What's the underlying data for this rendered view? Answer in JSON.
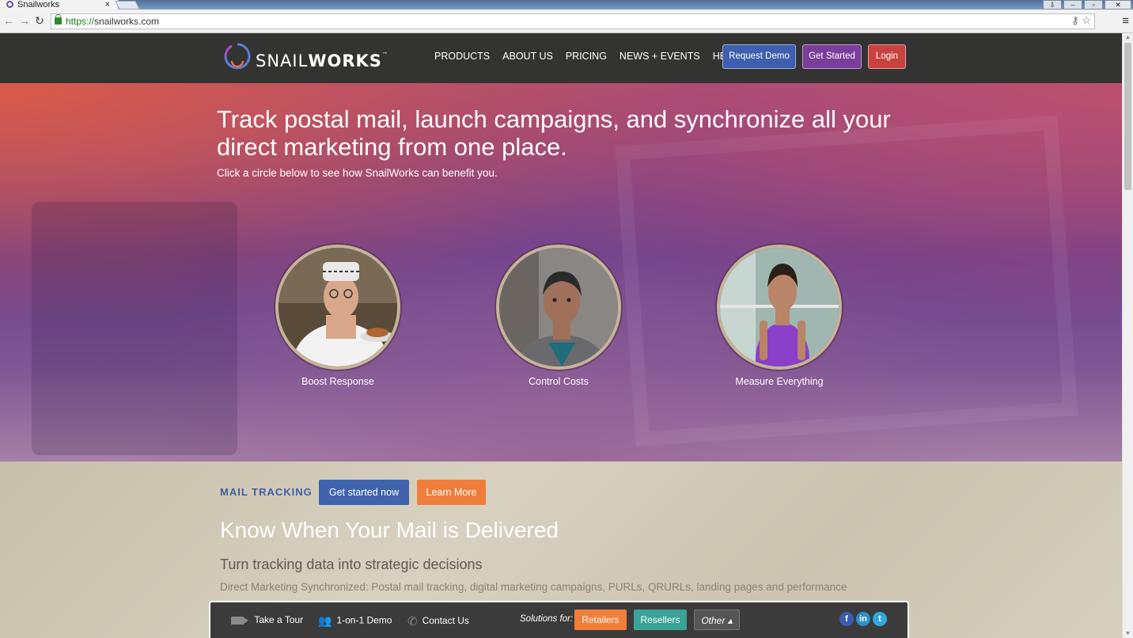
{
  "browser": {
    "tab_title": "Snailworks",
    "tab_close": "×",
    "url_scheme": "https://",
    "url_host": "snailworks.com"
  },
  "nav": {
    "logo_light": "SNAIL",
    "logo_bold": "WORKS",
    "logo_tm": "™",
    "links": [
      "PRODUCTS",
      "ABOUT US",
      "PRICING",
      "NEWS + EVENTS",
      "HELP"
    ],
    "request_demo": "Request Demo",
    "get_started": "Get Started",
    "login": "Login"
  },
  "hero": {
    "title": "Track postal mail, launch campaigns, and synchronize all your direct marketing from one place.",
    "subtitle": "Click a circle below to see how SnailWorks can benefit you.",
    "circles": [
      {
        "label": "Boost Response"
      },
      {
        "label": "Control Costs"
      },
      {
        "label": "Measure Everything"
      }
    ]
  },
  "mail_tracking": {
    "label": "MAIL TRACKING",
    "get_started_now": "Get started now",
    "learn_more": "Learn More",
    "title": "Know When Your Mail is Delivered",
    "subtitle": "Turn tracking data into strategic decisions",
    "body": "Direct Marketing Synchronized: Postal mail tracking, digital marketing campaigns, PURLs, QRURLs, landing pages and performance"
  },
  "floatbar": {
    "take_tour": "Take a Tour",
    "demo": "1-on-1 Demo",
    "contact": "Contact Us",
    "solutions_for": "Solutions for:",
    "retailers": "Retailers",
    "resellers": "Resellers",
    "other": "Other ▴",
    "social": {
      "facebook": "f",
      "linkedin": "in",
      "twitter": "t"
    }
  },
  "colors": {
    "nav_bg": "#333332",
    "request_demo": "#3d5fb0",
    "get_started": "#7a3d9b",
    "login": "#c9433e",
    "accent_blue": "#3f63ad",
    "accent_orange": "#ef7e3b",
    "accent_teal": "#3aa396"
  }
}
